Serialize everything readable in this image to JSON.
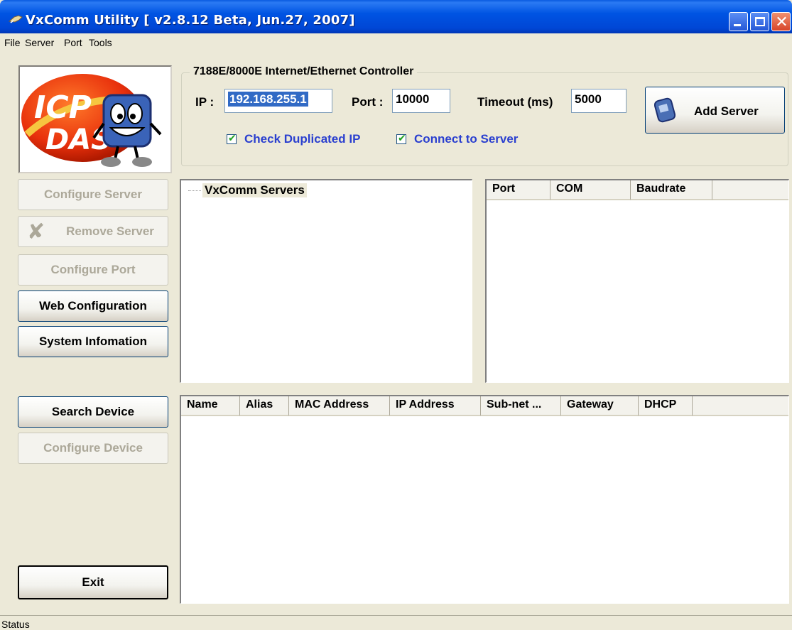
{
  "window": {
    "title": "VxComm Utility [ v2.8.12 Beta, Jun.27, 2007]",
    "controls": [
      "minimize",
      "maximize",
      "close"
    ]
  },
  "menu": [
    "File",
    "Server",
    "Port",
    "Tools"
  ],
  "logo": {
    "text_top": "ICP",
    "text_bottom": "DAS"
  },
  "left_buttons": {
    "configure_server": "Configure Server",
    "remove_server": "Remove Server",
    "configure_port": "Configure Port",
    "web_configuration": "Web Configuration",
    "system_information": "System Infomation",
    "search_device": "Search Device",
    "configure_device": "Configure Device",
    "exit": "Exit"
  },
  "controller": {
    "group_title": "7188E/8000E Internet/Ethernet Controller",
    "ip_label": "IP :",
    "ip_value": "192.168.255.1",
    "port_label": "Port :",
    "port_value": "10000",
    "timeout_label": "Timeout (ms)",
    "timeout_value": "5000",
    "check_duplicated_ip": "Check Duplicated IP",
    "check_duplicated_ip_checked": true,
    "connect_to_server": "Connect to Server",
    "connect_to_server_checked": true,
    "add_server": "Add Server"
  },
  "servers_tree": {
    "root": "VxComm Servers"
  },
  "port_list": {
    "columns": [
      "Port",
      "COM",
      "Baudrate"
    ]
  },
  "device_list": {
    "columns": [
      "Name",
      "Alias",
      "MAC Address",
      "IP Address",
      "Sub-net ...",
      "Gateway",
      "DHCP"
    ]
  },
  "status": "Status",
  "colors": {
    "titlebar": "#0054e3",
    "face": "#ece9d8",
    "checkbox_label": "#2a3fcf",
    "selection": "#316ac5"
  }
}
